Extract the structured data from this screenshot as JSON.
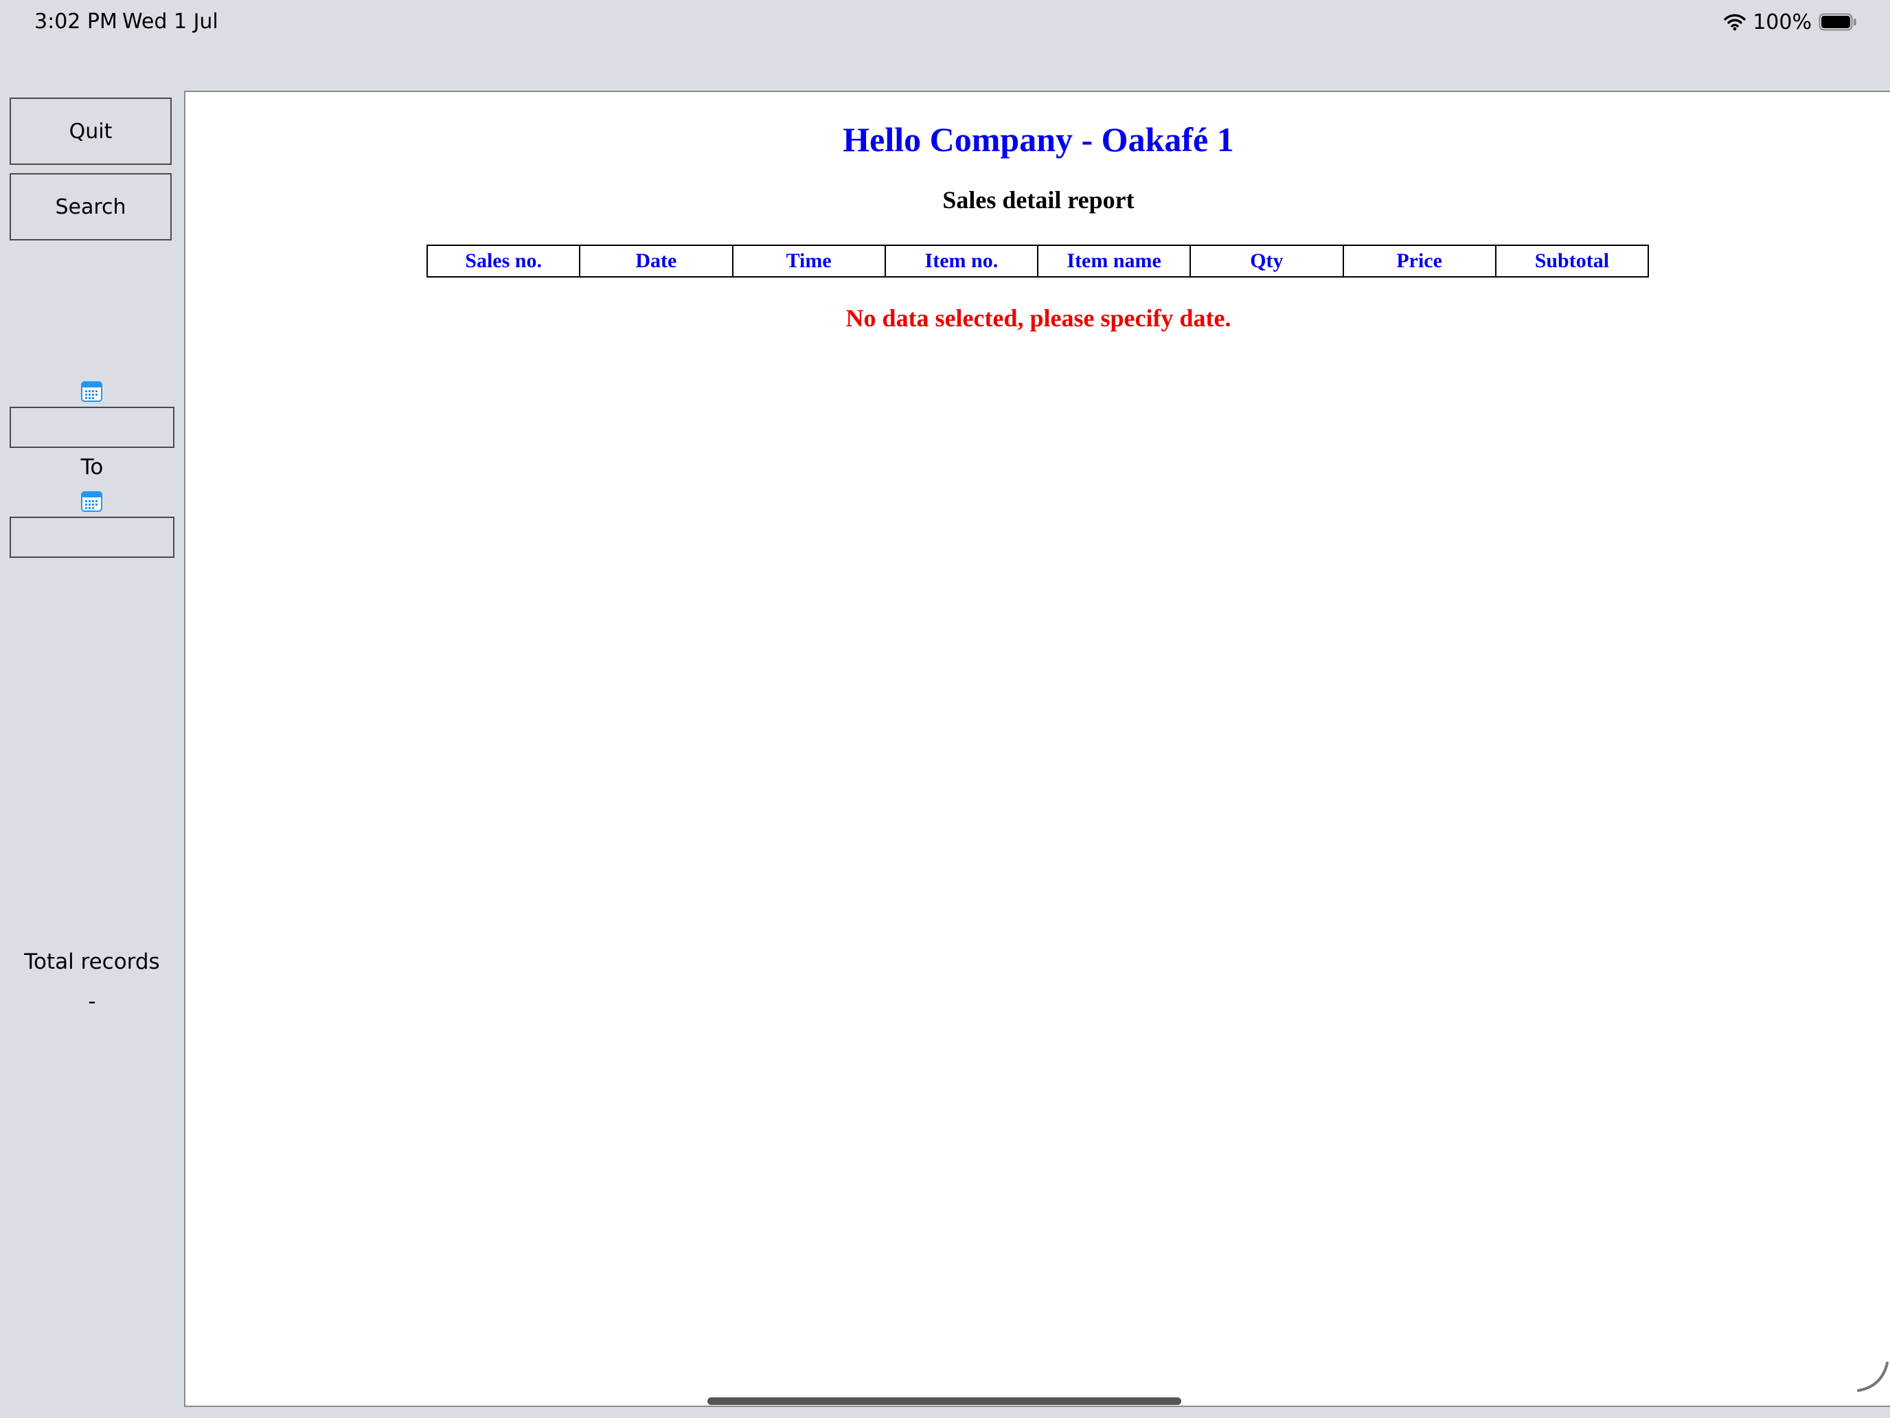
{
  "status_bar": {
    "time": "3:02 PM",
    "date": "Wed 1 Jul",
    "battery_percent": "100%",
    "icons": [
      "wifi-icon",
      "battery-icon"
    ]
  },
  "sidebar": {
    "quit_label": "Quit",
    "search_label": "Search",
    "date_from_value": "",
    "to_label": "To",
    "date_to_value": "",
    "total_records_label": "Total records",
    "total_records_value": "-",
    "icons": [
      "calendar-icon",
      "calendar-icon"
    ]
  },
  "report": {
    "company_title": "Hello Company - Oakafé 1",
    "subtitle": "Sales detail report",
    "columns": [
      "Sales no.",
      "Date",
      "Time",
      "Item no.",
      "Item name",
      "Qty",
      "Price",
      "Subtotal"
    ],
    "rows": [],
    "no_data_message": "No data selected, please specify date."
  },
  "colors": {
    "title_blue": "#0000ee",
    "error_red": "#ee0000",
    "chrome_gray": "#dadee4",
    "calendar_blue": "#2196f3"
  }
}
